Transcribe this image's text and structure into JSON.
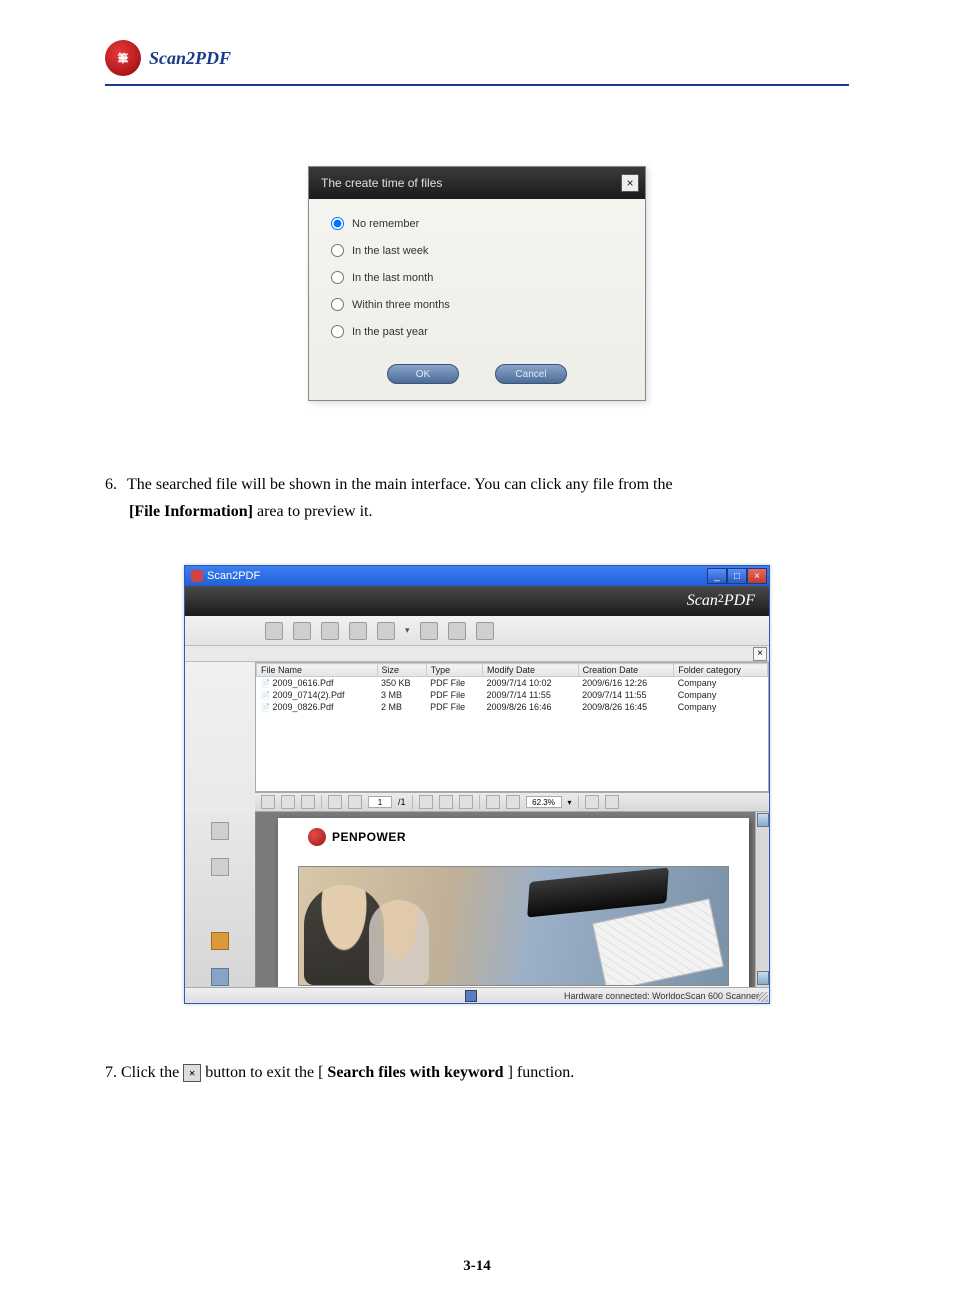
{
  "header": {
    "title": "Scan2PDF"
  },
  "dialog": {
    "title": "The create time of files",
    "options": [
      {
        "label": "No remember",
        "selected": true
      },
      {
        "label": "In the last week",
        "selected": false
      },
      {
        "label": "In the last month",
        "selected": false
      },
      {
        "label": "Within three months",
        "selected": false
      },
      {
        "label": "In the past year",
        "selected": false
      }
    ],
    "ok": "OK",
    "cancel": "Cancel"
  },
  "step6": {
    "num": "6.",
    "line1": "The searched file will be shown in the main interface. You can click any file from the",
    "line2_prefix": "[File Information]",
    "line2_rest": " area to preview it."
  },
  "appshot": {
    "title": "Scan2PDF",
    "brand": "Scan2PDF",
    "columns": [
      "File Name",
      "Size",
      "Type",
      "Modify Date",
      "Creation Date",
      "Folder category"
    ],
    "rows": [
      {
        "name": "2009_0616.Pdf",
        "size": "350 KB",
        "type": "PDF File",
        "mod": "2009/7/14 10:02",
        "cre": "2009/6/16 12:26",
        "folder": "Company"
      },
      {
        "name": "2009_0714(2).Pdf",
        "size": "3 MB",
        "type": "PDF File",
        "mod": "2009/7/14 11:55",
        "cre": "2009/7/14 11:55",
        "folder": "Company"
      },
      {
        "name": "2009_0826.Pdf",
        "size": "2 MB",
        "type": "PDF File",
        "mod": "2009/8/26 16:46",
        "cre": "2009/8/26 16:45",
        "folder": "Company"
      }
    ],
    "page_field": "1",
    "page_total": "/1",
    "zoom": "62.3%",
    "penpower": "PENPOWER",
    "status": "Hardware connected: WorldocScan 600 Scanner"
  },
  "step7": {
    "num": "7.",
    "before": "Click the",
    "after1": "button to exit the [",
    "bold": "Search files with keyword",
    "after2": "] function."
  },
  "pagenum": "3-14"
}
